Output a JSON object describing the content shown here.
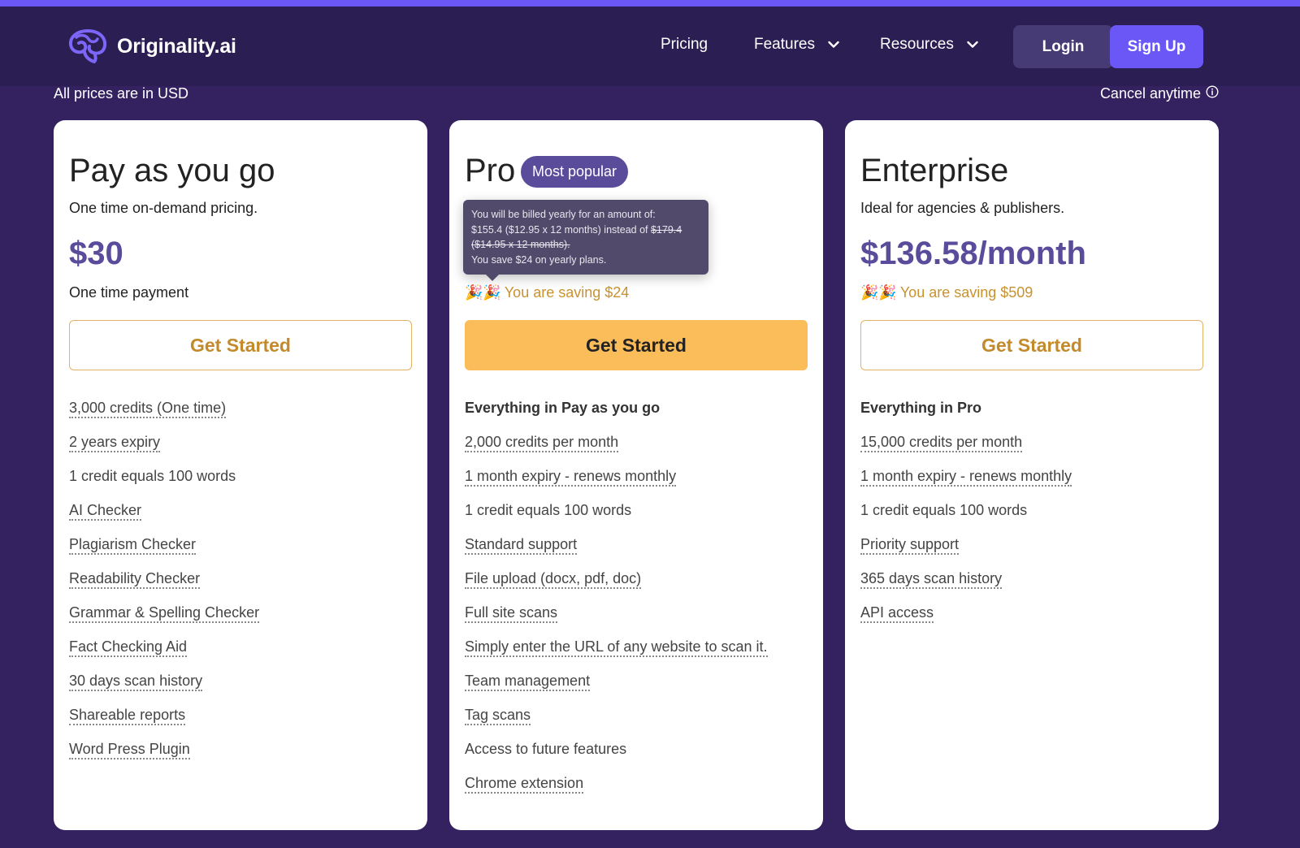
{
  "brand": {
    "name": "Originality.ai",
    "logo_icon": "brain-icon"
  },
  "nav": {
    "pricing": "Pricing",
    "features": "Features",
    "resources": "Resources",
    "login": "Login",
    "signup": "Sign Up"
  },
  "notes": {
    "usd": "All prices are in USD",
    "cancel": "Cancel anytime"
  },
  "colors": {
    "accent": "#6a57f5",
    "price": "#5b4b9b",
    "cta": "#fbbc5a",
    "saving": "#c8922e",
    "background": "#33225f"
  },
  "plans": [
    {
      "title": "Pay as you go",
      "subtitle": "One time on-demand pricing.",
      "price": "$30",
      "price_note": "One time payment",
      "cta": "Get Started",
      "features": [
        "3,000 credits (One time)",
        "2 years expiry",
        "1 credit equals 100 words",
        "AI Checker",
        "Plagiarism Checker",
        "Readability Checker",
        "Grammar & Spelling Checker",
        "Fact Checking Aid",
        "30 days scan history",
        "Shareable reports",
        "Word Press Plugin"
      ]
    },
    {
      "title": "Pro",
      "badge": "Most popular",
      "tooltip": {
        "line1": "You will be billed yearly for an amount of:",
        "line2a": "$155.4 ($12.95 x 12 months) instead of ",
        "line2b": "$179.4",
        "line3": "($14.95 x 12 months).",
        "line4": "You save $24 on yearly plans."
      },
      "saving": "You are saving $24",
      "cta": "Get Started",
      "heading": "Everything in Pay as you go",
      "features": [
        "2,000 credits per month",
        "1 month expiry - renews monthly",
        "1 credit equals 100 words",
        "Standard support",
        "File upload (docx, pdf, doc)",
        "Full site scans",
        "Simply enter the URL of any website to scan it.",
        "Team management",
        "Tag scans",
        "Access to future features",
        "Chrome extension"
      ]
    },
    {
      "title": "Enterprise",
      "subtitle": "Ideal for agencies & publishers.",
      "price": "$136.58/month",
      "saving": "You are saving $509",
      "cta": "Get Started",
      "heading": "Everything in Pro",
      "features": [
        "15,000 credits per month",
        "1 month expiry - renews monthly",
        "1 credit equals 100 words",
        "Priority support",
        "365 days scan history",
        "API access"
      ]
    }
  ]
}
